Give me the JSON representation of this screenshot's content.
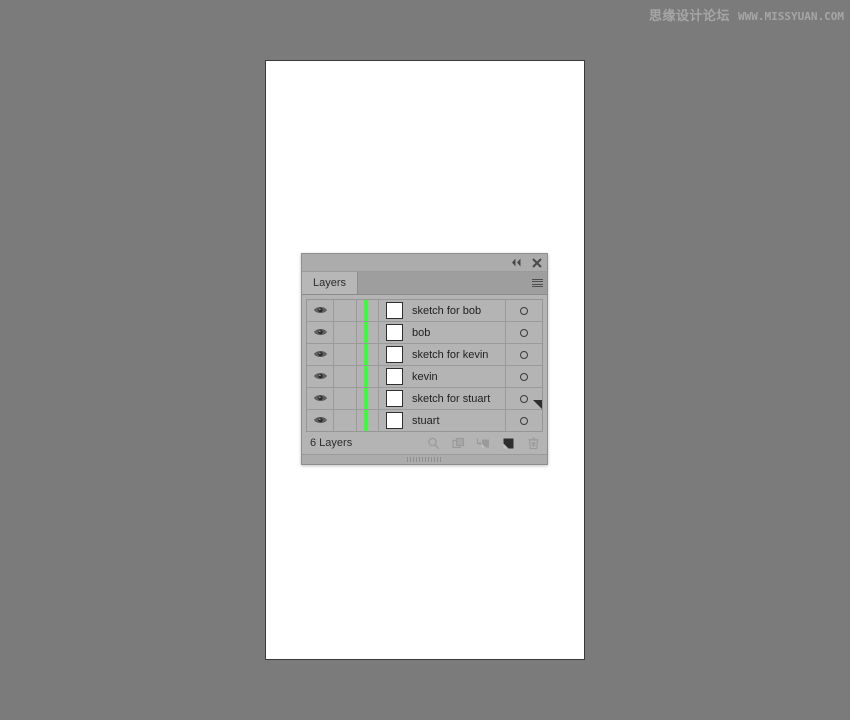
{
  "watermark": {
    "cn_text": "思缘设计论坛",
    "en_text": "WWW.MISSYUAN.COM"
  },
  "colors": {
    "app_background": "#7b7b7b",
    "artboard": "#ffffff",
    "panel_background": "#b4b4b4",
    "panel_titlebar": "#acacac",
    "tabbar": "#9e9e9e",
    "active_tab": "#b7b7b7",
    "layer_color_strip": "#3dfa3d",
    "text": "#1f1f1f"
  },
  "panel": {
    "titlebar": {
      "collapse_label": "collapse-panel",
      "close_label": "close-panel"
    },
    "tab": {
      "label": "Layers",
      "menu_label": "panel-menu"
    },
    "columns": {
      "visibility": "Visibility",
      "lock": "Lock",
      "color": "Layer Color",
      "thumbnail": "Thumbnail",
      "name": "Name",
      "target": "Target"
    },
    "layers": [
      {
        "name": "sketch for bob",
        "visible": true,
        "locked": false,
        "color": "#3dfa3d",
        "targeted": false
      },
      {
        "name": "bob",
        "visible": true,
        "locked": false,
        "color": "#3dfa3d",
        "targeted": false
      },
      {
        "name": "sketch for kevin",
        "visible": true,
        "locked": false,
        "color": "#3dfa3d",
        "targeted": false
      },
      {
        "name": "kevin",
        "visible": true,
        "locked": false,
        "color": "#3dfa3d",
        "targeted": false
      },
      {
        "name": "sketch for stuart",
        "visible": true,
        "locked": false,
        "color": "#3dfa3d",
        "targeted": false
      },
      {
        "name": "stuart",
        "visible": true,
        "locked": false,
        "color": "#3dfa3d",
        "targeted": false
      }
    ],
    "footer": {
      "count_label": "6 Layers",
      "tools": [
        {
          "name": "locate-object",
          "tooltip": "Locate Object",
          "enabled": true
        },
        {
          "name": "make-clipping-mask",
          "tooltip": "Make/Release Clipping Mask",
          "enabled": true
        },
        {
          "name": "create-new-sublayer",
          "tooltip": "Create New Sublayer",
          "enabled": true
        },
        {
          "name": "create-new-layer",
          "tooltip": "Create New Layer",
          "enabled": true
        },
        {
          "name": "delete-selection",
          "tooltip": "Delete Selection",
          "enabled": true
        }
      ]
    }
  }
}
